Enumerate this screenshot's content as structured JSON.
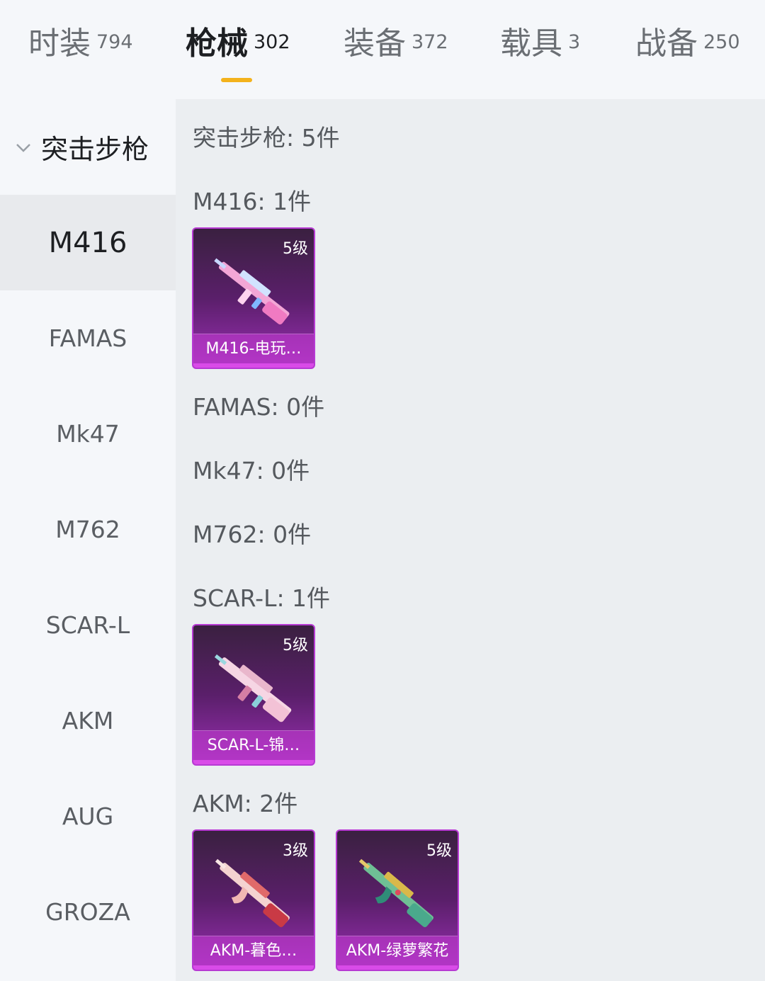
{
  "tabs": [
    {
      "label": "时装",
      "count": "794",
      "active": false
    },
    {
      "label": "枪械",
      "count": "302",
      "active": true
    },
    {
      "label": "装备",
      "count": "372",
      "active": false
    },
    {
      "label": "载具",
      "count": "3",
      "active": false
    },
    {
      "label": "战备",
      "count": "250",
      "active": false
    }
  ],
  "sidebar": {
    "category": "突击步枪",
    "items": [
      "M416",
      "FAMAS",
      "Mk47",
      "M762",
      "SCAR-L",
      "AKM",
      "AUG",
      "GROZA"
    ],
    "selected": "M416"
  },
  "content": {
    "summary": "突击步枪: 5件",
    "sections": [
      {
        "title": "M416: 1件",
        "items": [
          {
            "level": "5级",
            "name": "M416-电玩…",
            "icon": "m416-skin-icon"
          }
        ]
      },
      {
        "title": "FAMAS: 0件",
        "items": []
      },
      {
        "title": "Mk47: 0件",
        "items": []
      },
      {
        "title": "M762: 0件",
        "items": []
      },
      {
        "title": "SCAR-L: 1件",
        "items": [
          {
            "level": "5级",
            "name": "SCAR-L-锦…",
            "icon": "scar-l-skin-icon"
          }
        ]
      },
      {
        "title": "AKM: 2件",
        "items": [
          {
            "level": "3级",
            "name": "AKM-暮色…",
            "icon": "akm-skin-icon"
          },
          {
            "level": "5级",
            "name": "AKM-绿萝繁花",
            "icon": "akm-skin-icon"
          }
        ]
      }
    ]
  },
  "colors": {
    "accent_underline": "#f3b21c",
    "card_purple": "#9b2fb4",
    "card_border": "#b73ad3"
  }
}
